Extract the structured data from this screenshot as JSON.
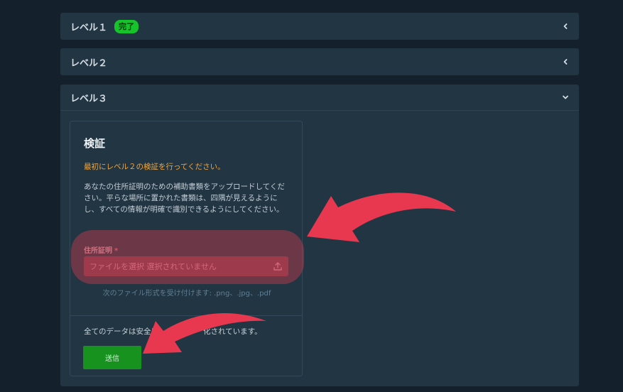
{
  "accordion": {
    "level1": {
      "title": "レベル１",
      "badge": "完了"
    },
    "level2": {
      "title": "レベル２"
    },
    "level3": {
      "title": "レベル３"
    }
  },
  "verification": {
    "title": "検証",
    "warning": "最初にレベル２の検証を行ってください。",
    "description": "あなたの住所証明のための補助書類をアップロードしてください。平らな場所に置かれた書類は、四隅が見えるようにし、すべての情報が明確で識別できるようにしてください。",
    "field_label": "住所証明",
    "required_mark": "*",
    "file_input_text": "ファイルを選択 選択されていません",
    "accepted_formats": "次のファイル形式を受け付けます: .png、.jpg、.pdf",
    "secure_note": "全てのデータは安全に　　　　　　化されています。",
    "submit_label": "送信"
  },
  "colors": {
    "background": "#14202b",
    "panel": "#213543",
    "badge": "#16c32a",
    "warning": "#f3a53b",
    "submit": "#17921f",
    "arrow": "#e8384f"
  },
  "icons": [
    "chevron-left-icon",
    "chevron-down-icon",
    "upload-icon",
    "arrow-annotation"
  ]
}
